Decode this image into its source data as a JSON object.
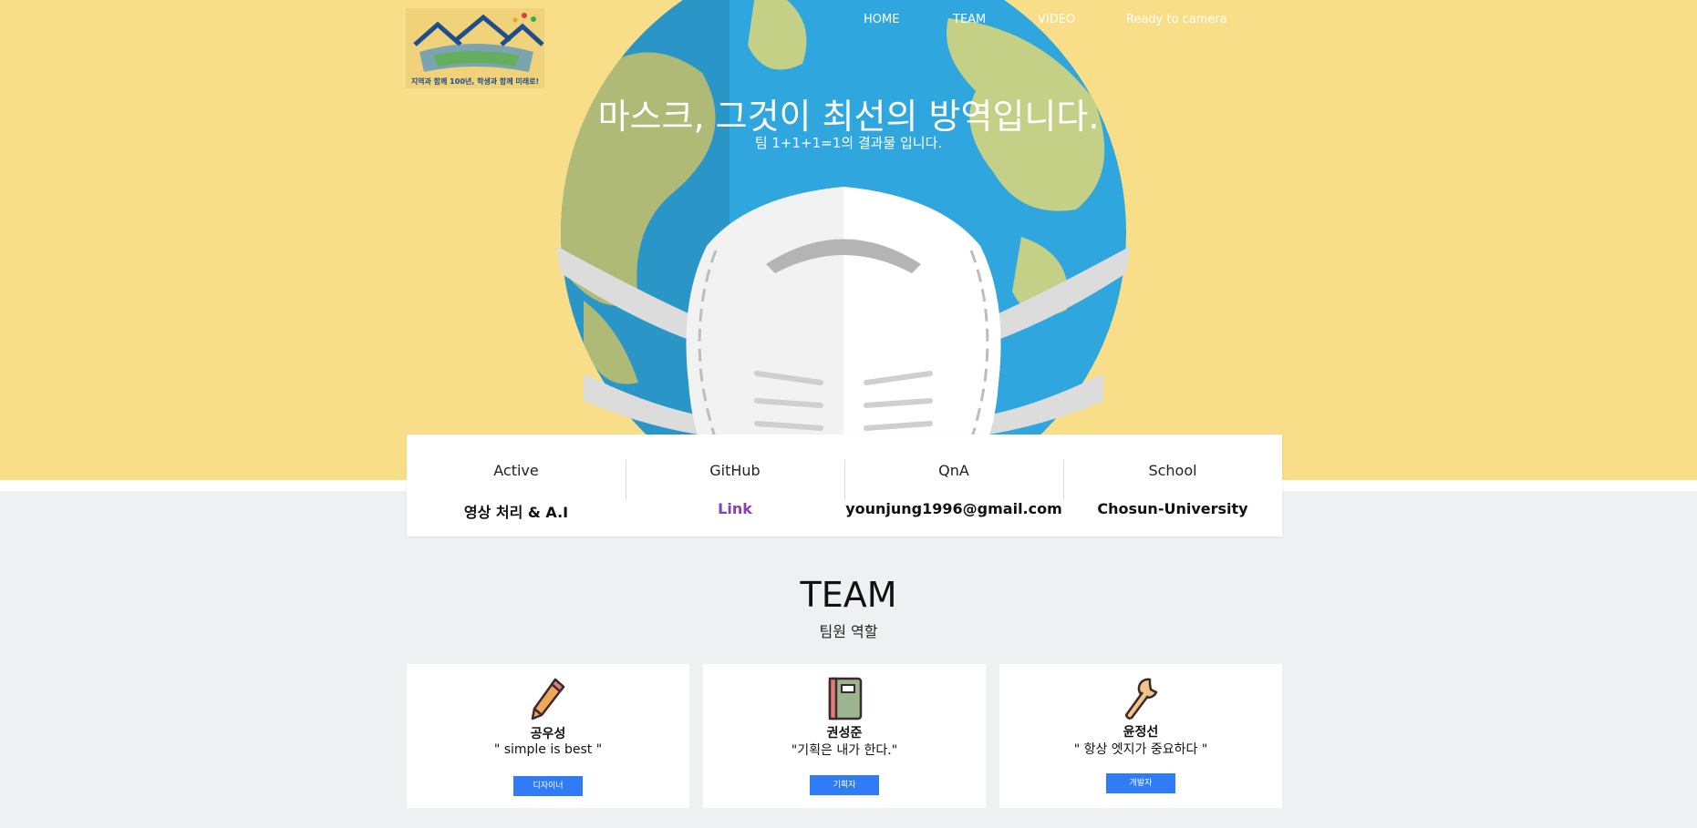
{
  "logo": {
    "tagline": "지역과 함께 100년, 학생과 함께 미래로!"
  },
  "nav": {
    "items": [
      "HOME",
      "TEAM",
      "VIDEO",
      "Ready to camera"
    ]
  },
  "hero": {
    "title": "마스크, 그것이 최선의 방역입니다.",
    "subtitle": "팀 1+1+1=1의 결과물 입니다."
  },
  "info": [
    {
      "label": "Active",
      "value": "영상 처리 & A.I"
    },
    {
      "label": "GitHub",
      "value": "Link"
    },
    {
      "label": "QnA",
      "value": "younjung1996@gmail.com"
    },
    {
      "label": "School",
      "value": "Chosun-University"
    }
  ],
  "team": {
    "title": "TEAM",
    "subtitle": "팀원 역할",
    "members": [
      {
        "name": "공우성",
        "quote": "\" simple is best \"",
        "role": "디자이너",
        "icon": "pencil-icon"
      },
      {
        "name": "권성준",
        "quote": "\"기획은 내가 한다.\"",
        "role": "기획자",
        "icon": "notebook-icon"
      },
      {
        "name": "윤정선",
        "quote": "\" 항상 엣지가 중요하다 \"",
        "role": "개발자",
        "icon": "wrench-icon"
      }
    ]
  },
  "colors": {
    "hero_bg": "#f8de88",
    "page_bg": "#eff0f2",
    "accent": "#2f7cf6",
    "link": "#8a3fb5"
  }
}
